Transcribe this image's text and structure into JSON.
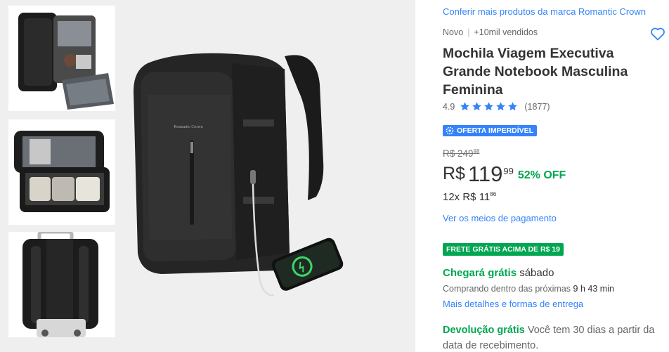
{
  "gallery": {
    "thumbnails": [
      "backpack-open-packed",
      "backpack-compartments-clothes",
      "backpack-back-trolley-strap"
    ],
    "main_image": "black-travel-backpack-with-phone-charging",
    "main_label": "Romantic Crown"
  },
  "product": {
    "brand_link": "Conferir mais produtos da marca Romantic Crown",
    "condition": "Novo",
    "sold": "+10mil vendidos",
    "title": "Mochila Viagem Executiva Grande Notebook Masculina Feminina",
    "rating": "4.9",
    "stars": 5,
    "reviews": "(1877)",
    "offer_badge": "OFERTA IMPERDÍVEL",
    "old_price_int": "R$ 249",
    "old_price_cents": "98",
    "currency": "R$",
    "price_int": "119",
    "price_cents": "99",
    "discount": "52% OFF",
    "installments": "12x R$ 11",
    "installments_cents": "86",
    "payment_link": "Ver os meios de pagamento",
    "shipping_badge": "FRETE GRÁTIS ACIMA DE R$ 19",
    "delivery_green": "Chegará grátis",
    "delivery_day": "sábado",
    "buying_prefix": "Comprando dentro das próximas",
    "buying_time": "9 h 43 min",
    "delivery_link": "Mais detalhes e formas de entrega",
    "return_green": "Devolução grátis",
    "return_text": "Você tem 30 dias a partir da data de recebimento."
  },
  "colors": {
    "link": "#3483fa",
    "green": "#00a650",
    "badge_blue": "#3483fa"
  }
}
